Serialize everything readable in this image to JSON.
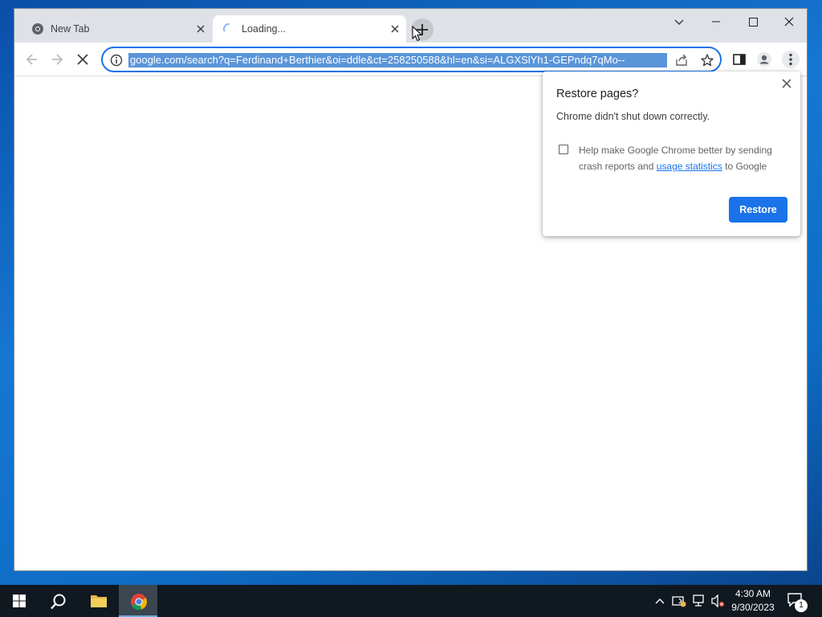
{
  "browser": {
    "tabs": [
      {
        "title": "New Tab",
        "state": "inactive"
      },
      {
        "title": "Loading...",
        "state": "active"
      }
    ],
    "address_bar": {
      "url": "google.com/search?q=Ferdinand+Berthier&oi=ddle&ct=258250588&hl=en&si=ALGXSlYh1-GEPndq7qMo--"
    }
  },
  "restore_popup": {
    "title": "Restore pages?",
    "message": "Chrome didn't shut down correctly.",
    "consent_prefix": "Help make Google Chrome better by sending crash reports and",
    "consent_link": "usage statistics",
    "consent_suffix": "to Google",
    "restore_label": "Restore"
  },
  "taskbar": {
    "time": "4:30 AM",
    "date": "9/30/2023",
    "notification_count": "1"
  },
  "colors": {
    "accent": "#1a73e8",
    "titlebar": "#dee1e6",
    "taskbar": "#101820"
  }
}
